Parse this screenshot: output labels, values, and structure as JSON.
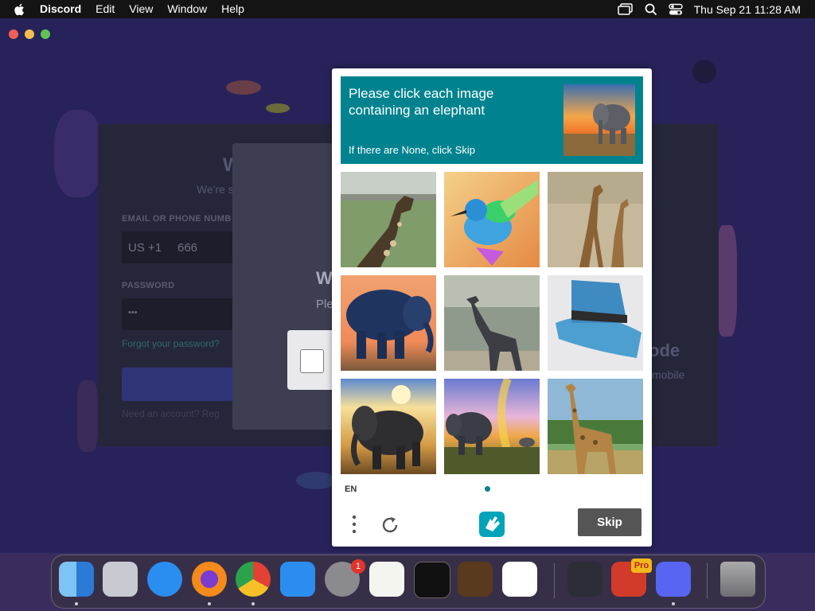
{
  "menubar": {
    "app_name": "Discord",
    "items": [
      "Edit",
      "View",
      "Window",
      "Help"
    ],
    "clock": "Thu Sep 21  11:28 AM"
  },
  "login": {
    "email_label": "EMAIL OR PHONE NUMB",
    "country_code": "US +1",
    "phone_value": "666",
    "password_label": "PASSWORD",
    "password_value": "•••",
    "forgot_link": "Forgot your password?",
    "register_text": "Need an account? Reg",
    "heading_partial": "W",
    "subheading_partial": "We're s",
    "qr_title": "ode",
    "qr_sub": "mobile"
  },
  "modal": {
    "title_partial": "W",
    "sub_partial": "Ple"
  },
  "captcha": {
    "prompt": "Please click each image containing an elephant",
    "prompt_sub": "If there are None, click Skip",
    "language": "EN",
    "skip_label": "Skip",
    "accent_color": "#00838f",
    "tiles": [
      {
        "subject": "giraffe"
      },
      {
        "subject": "hummingbird"
      },
      {
        "subject": "giraffes"
      },
      {
        "subject": "elephant"
      },
      {
        "subject": "giraffe"
      },
      {
        "subject": "hat"
      },
      {
        "subject": "elephant"
      },
      {
        "subject": "elephant"
      },
      {
        "subject": "giraffe"
      }
    ]
  },
  "dock": {
    "apps": [
      "Finder",
      "Launchpad",
      "Safari",
      "Firefox",
      "Chrome",
      "App Store",
      "System Settings",
      "TextEdit",
      "Terminal",
      "GarageBand",
      "VS Code",
      "Affinity",
      "Video Editor Pro",
      "Discord",
      "Trash"
    ],
    "settings_badge": "1",
    "pro_badge": "Pro"
  }
}
